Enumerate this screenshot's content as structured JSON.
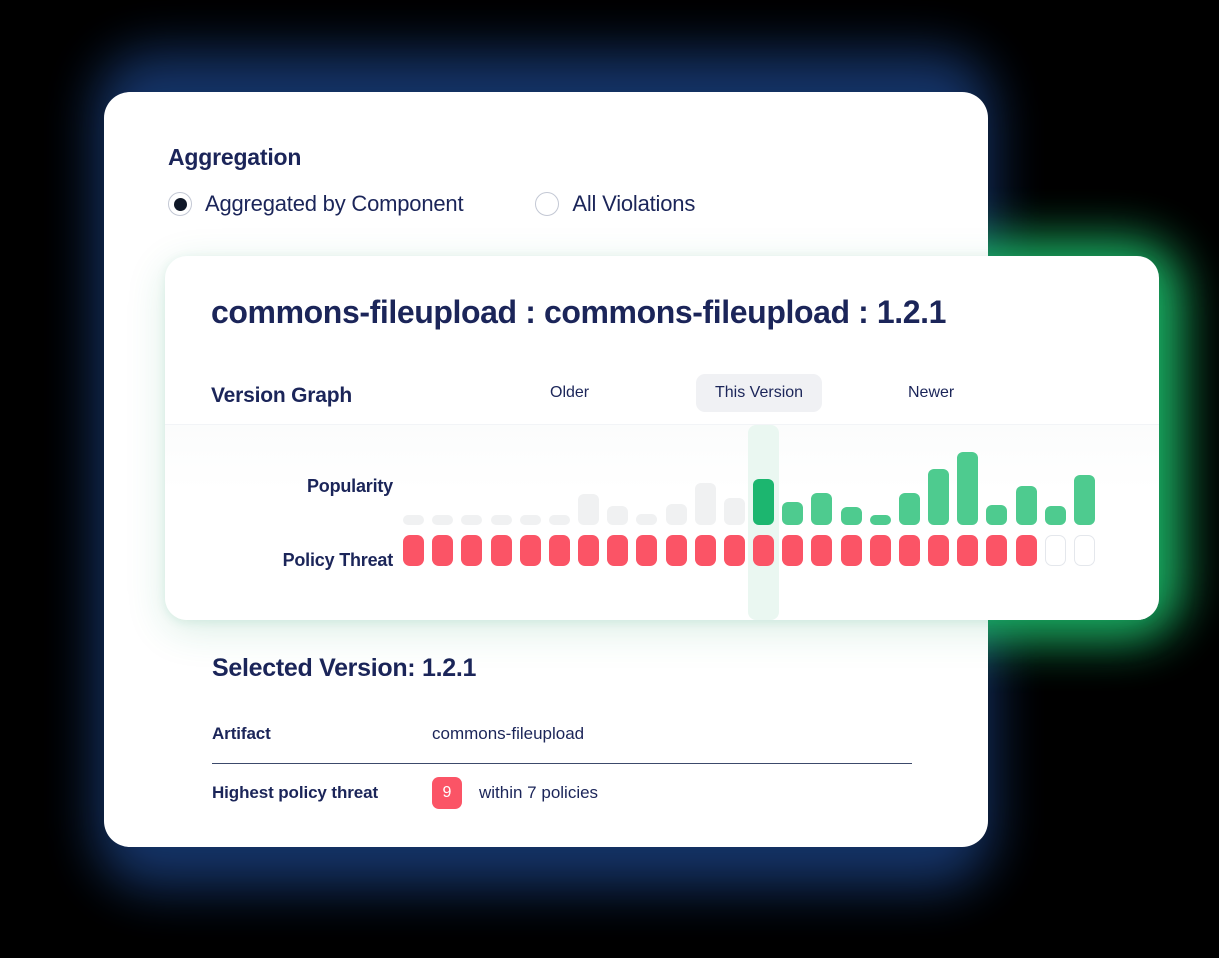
{
  "aggregation": {
    "title": "Aggregation",
    "options": [
      {
        "label": "Aggregated by Component",
        "selected": true
      },
      {
        "label": "All Violations",
        "selected": false
      }
    ]
  },
  "graph_card": {
    "title": "commons-fileupload : commons-fileupload : 1.2.1",
    "version_graph_label": "Version Graph",
    "range_tabs": [
      {
        "label": "Older",
        "active": false
      },
      {
        "label": "This Version",
        "active": true
      },
      {
        "label": "Newer",
        "active": false
      }
    ],
    "row_labels": {
      "popularity": "Popularity",
      "policy_threat": "Policy Threat"
    }
  },
  "details": {
    "selected_version_title": "Selected Version: 1.2.1",
    "rows": [
      {
        "key": "Artifact",
        "value": "commons-fileupload"
      },
      {
        "key": "Highest policy threat",
        "badge": "9",
        "value": "within 7 policies"
      }
    ]
  },
  "colors": {
    "brand_navy": "#1b2559",
    "green_selected": "#1cb66f",
    "green_bar": "#4ecb8f",
    "grey_bar": "#f0f1f2",
    "threat_red": "#fb5466",
    "threat_empty_border": "#e4e7ec",
    "selection_band": "#e6f6ee",
    "glow_blue": "#16376e",
    "glow_green": "#1fbf6c"
  },
  "chart_data": {
    "type": "bar",
    "title": "Version Graph",
    "xlabel": "",
    "ylabel": "Popularity",
    "grid": false,
    "legend": "none",
    "selected_index": 12,
    "bar_count": 24,
    "series": [
      {
        "name": "Popularity",
        "ylim": [
          0,
          100
        ],
        "values": [
          9,
          9,
          9,
          9,
          9,
          9,
          32,
          20,
          11,
          22,
          44,
          28,
          48,
          24,
          33,
          19,
          10,
          33,
          58,
          76,
          21,
          41,
          20,
          52
        ],
        "states": [
          "older",
          "older",
          "older",
          "older",
          "older",
          "older",
          "older",
          "older",
          "older",
          "older",
          "older",
          "older",
          "selected",
          "newer",
          "newer",
          "newer",
          "newer",
          "newer",
          "newer",
          "newer",
          "newer",
          "newer",
          "newer",
          "newer"
        ]
      },
      {
        "name": "Policy Threat",
        "type": "heatmap",
        "values": [
          "filled",
          "filled",
          "filled",
          "filled",
          "filled",
          "filled",
          "filled",
          "filled",
          "filled",
          "filled",
          "filled",
          "filled",
          "filled",
          "filled",
          "filled",
          "filled",
          "filled",
          "filled",
          "filled",
          "filled",
          "filled",
          "filled",
          "empty",
          "empty"
        ]
      }
    ]
  }
}
